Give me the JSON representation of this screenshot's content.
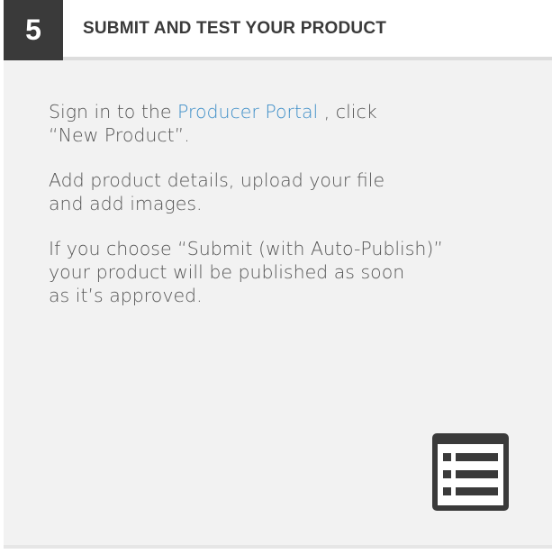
{
  "header": {
    "step_number": "5",
    "title": "SUBMIT AND TEST YOUR PRODUCT"
  },
  "content": {
    "paragraph1": {
      "before_link": "Sign in to the ",
      "link_text": "Producer Portal",
      "after_link": " , click",
      "line2": "“New Product”."
    },
    "paragraph2": {
      "line1": "Add product details, upload your file",
      "line2": "and add images."
    },
    "paragraph3": {
      "line1": "If you choose “Submit (with Auto-Publish)”",
      "line2": "your product will be published as soon",
      "line3": "as it’s approved."
    }
  },
  "icons": {
    "list": "list-icon"
  },
  "colors": {
    "badge_background": "#3a3a3a",
    "link": "#3f8fc8",
    "card_background": "#f2f2f2",
    "body_text": "#555555"
  }
}
